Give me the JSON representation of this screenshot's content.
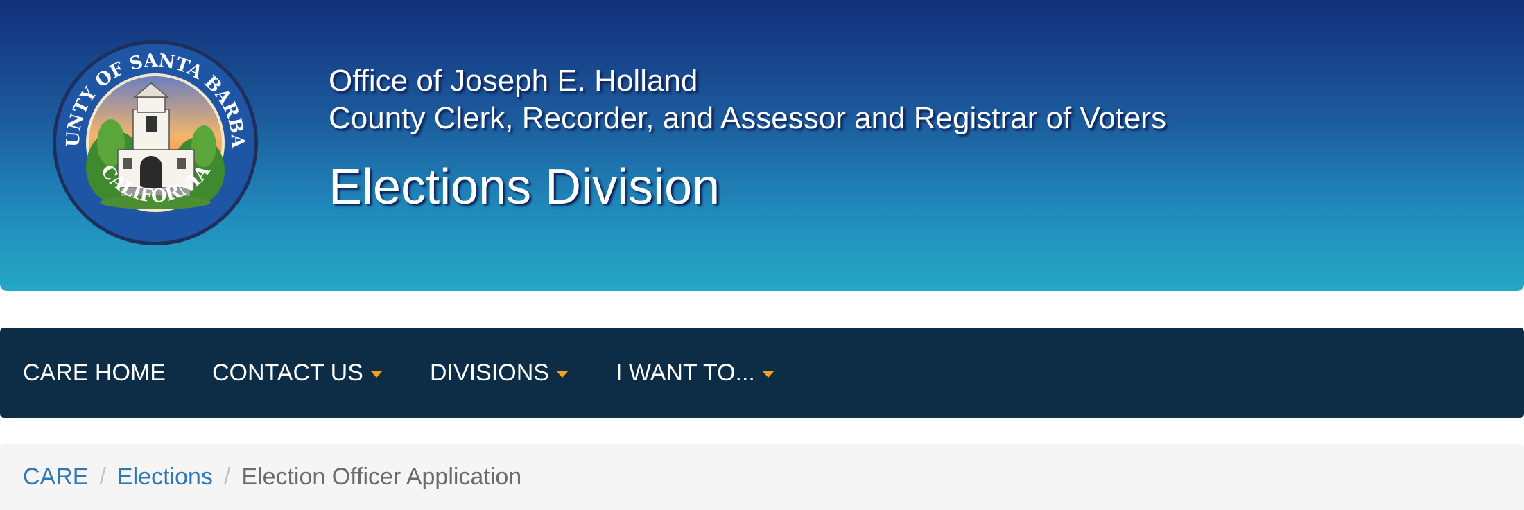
{
  "header": {
    "seal": {
      "top_text": "COUNTY OF SANTA BARBARA",
      "bottom_text": "CALIFORNIA"
    },
    "office_line_1": "Office of Joseph E. Holland",
    "office_line_2": "County Clerk, Recorder, and Assessor and Registrar of Voters",
    "division_title": "Elections Division",
    "colors": {
      "gradient_top": "#132f7a",
      "gradient_bottom": "#25a8c6"
    }
  },
  "nav": {
    "items": [
      {
        "label": "CARE HOME",
        "has_dropdown": false,
        "icon": ""
      },
      {
        "label": "CONTACT US",
        "has_dropdown": true,
        "icon": "caret-down-icon"
      },
      {
        "label": "DIVISIONS",
        "has_dropdown": true,
        "icon": "caret-down-icon"
      },
      {
        "label": "I WANT TO...",
        "has_dropdown": true,
        "icon": "caret-down-icon"
      }
    ],
    "colors": {
      "background": "#0c2d45",
      "caret": "#f0a21d"
    }
  },
  "breadcrumb": {
    "items": [
      {
        "label": "CARE",
        "link": true
      },
      {
        "label": "Elections",
        "link": true
      },
      {
        "label": "Election Officer Application",
        "link": false
      }
    ],
    "separator": "/",
    "colors": {
      "link": "#2f78b4",
      "current": "#6b6b6b"
    }
  }
}
